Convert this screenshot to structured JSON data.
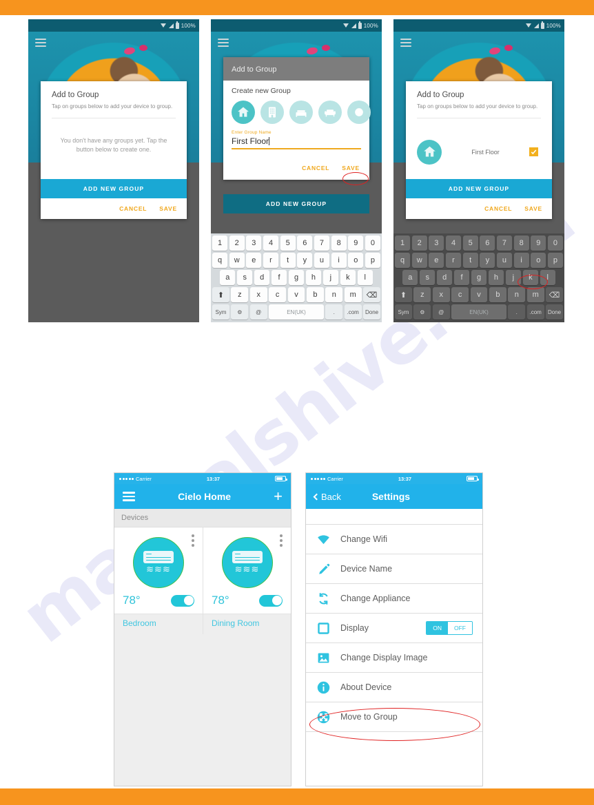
{
  "page": {
    "watermark": "manualshive.com",
    "accent_orange": "#F7941E",
    "accent_cyan": "#21b2ea",
    "annotation_color": "#e02020"
  },
  "android_status": {
    "battery_pct": "100%"
  },
  "phone1": {
    "dialog_title": "Add to Group",
    "dialog_subtitle": "Tap on groups below to add your device to group.",
    "empty_text": "You don't have any groups yet. Tap the button below to create one.",
    "add_button": "ADD NEW GROUP",
    "cancel": "CANCEL",
    "save": "SAVE"
  },
  "phone2": {
    "header_title": "Add to Group",
    "create_title": "Create new Group",
    "icons": [
      "home-icon",
      "building-icon",
      "bed-icon",
      "sofa-icon",
      "partial-icon"
    ],
    "field_label": "Enter Group Name",
    "field_value": "First Floor",
    "cancel": "CANCEL",
    "save": "SAVE",
    "add_button": "ADD NEW GROUP"
  },
  "phone3": {
    "dialog_title": "Add to Group",
    "dialog_subtitle": "Tap on groups below to add your device to group.",
    "group_name": "First Floor",
    "group_checked": true,
    "add_button": "ADD NEW GROUP",
    "cancel": "CANCEL",
    "save": "SAVE"
  },
  "keyboard": {
    "row1": [
      "1",
      "2",
      "3",
      "4",
      "5",
      "6",
      "7",
      "8",
      "9",
      "0"
    ],
    "row2": [
      "q",
      "w",
      "e",
      "r",
      "t",
      "y",
      "u",
      "i",
      "o",
      "p"
    ],
    "row3": [
      "a",
      "s",
      "d",
      "f",
      "g",
      "h",
      "j",
      "k",
      "l"
    ],
    "row4": [
      "z",
      "x",
      "c",
      "v",
      "b",
      "n",
      "m"
    ],
    "shift": "⬆",
    "delete": "⌫",
    "sym": "Sym",
    "gear": "⚙",
    "at": "@",
    "space": "EN(UK)",
    "period": ".",
    "dotcom": ".com",
    "done": "Done"
  },
  "ios_status": {
    "carrier": "Carrier",
    "time": "13:37"
  },
  "home": {
    "title": "Cielo Home",
    "section": "Devices",
    "devices": [
      {
        "name": "Bedroom",
        "temp": "78°",
        "power_on": true
      },
      {
        "name": "Dining Room",
        "temp": "78°",
        "power_on": true
      }
    ]
  },
  "settings": {
    "back": "Back",
    "title": "Settings",
    "items": [
      {
        "label": "Change Wifi",
        "icon": "wifi-icon",
        "toggle": null
      },
      {
        "label": "Device Name",
        "icon": "pencil-icon",
        "toggle": null
      },
      {
        "label": "Change Appliance",
        "icon": "refresh-icon",
        "toggle": null
      },
      {
        "label": "Display",
        "icon": "display-icon",
        "toggle": {
          "on": "ON",
          "off": "OFF",
          "value": "ON"
        }
      },
      {
        "label": "Change Display Image",
        "icon": "image-icon",
        "toggle": null
      },
      {
        "label": "About Device",
        "icon": "info-icon",
        "toggle": null
      },
      {
        "label": "Move to Group",
        "icon": "move-icon",
        "toggle": null
      }
    ]
  }
}
